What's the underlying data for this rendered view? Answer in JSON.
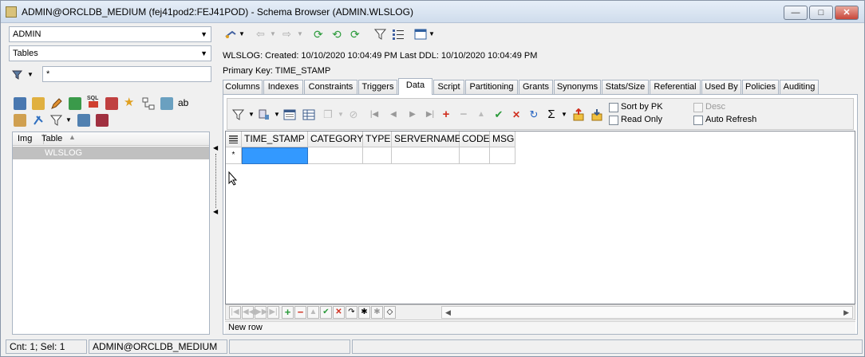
{
  "window": {
    "title": "ADMIN@ORCLDB_MEDIUM (fej41pod2:FEJ41POD) - Schema Browser (ADMIN.WLSLOG)",
    "minimize": "—",
    "maximize": "□",
    "close": "✕"
  },
  "left": {
    "schema_combo": "ADMIN",
    "object_type_combo": "Tables",
    "filter_value": "*",
    "table_list": {
      "headers": [
        "Img",
        "Table"
      ],
      "rows": [
        "WLSLOG"
      ]
    }
  },
  "info": {
    "created_line": "WLSLOG:  Created: 10/10/2020 10:04:49 PM   Last DDL: 10/10/2020 10:04:49 PM",
    "primary_key": "Primary Key:  TIME_STAMP"
  },
  "tabs": [
    "Columns",
    "Indexes",
    "Constraints",
    "Triggers",
    "Data",
    "Script",
    "Partitioning",
    "Grants",
    "Synonyms",
    "Stats/Size",
    "Referential",
    "Used By",
    "Policies",
    "Auditing"
  ],
  "active_tab": "Data",
  "data_options": {
    "sort_by_pk": "Sort by PK",
    "read_only": "Read Only",
    "desc": "Desc",
    "auto_refresh": "Auto Refresh"
  },
  "grid": {
    "columns": [
      "TIME_STAMP",
      "CATEGORY",
      "TYPE",
      "SERVERNAME",
      "CODE",
      "MSG"
    ],
    "new_row_indicator": "*"
  },
  "panel_status": "New row",
  "status_bar": {
    "count": "Cnt: 1; Sel: 1",
    "connection": "ADMIN@ORCLDB_MEDIUM"
  }
}
